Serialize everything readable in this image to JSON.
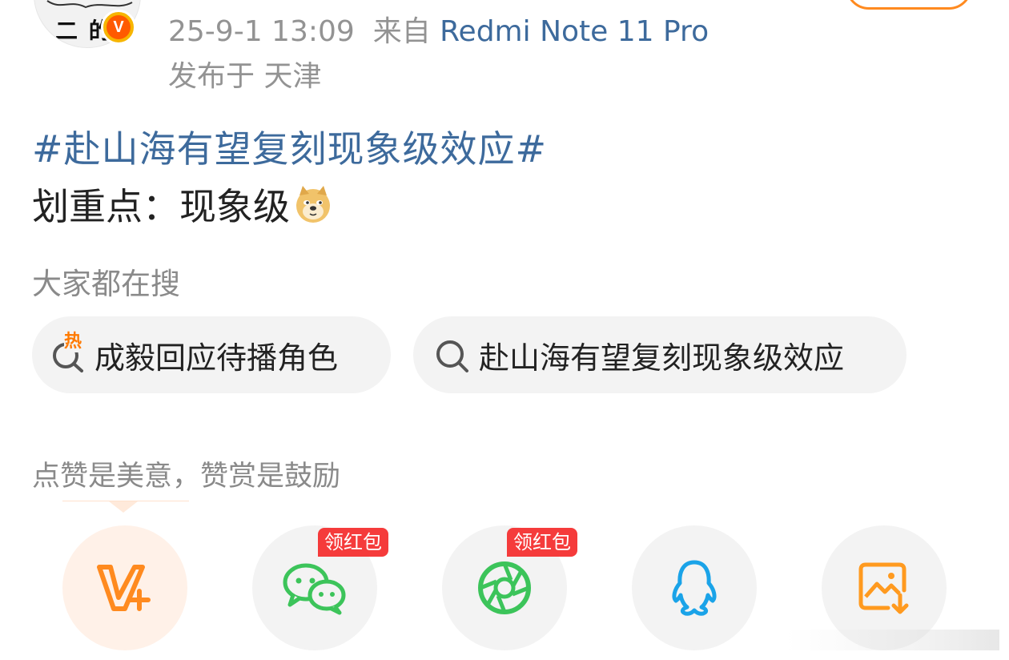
{
  "header": {
    "avatar_text": "二 的",
    "verified_badge": "V",
    "timestamp": "25-9-1 13:09",
    "from_label": "来自",
    "device": "Redmi Note 11 Pro",
    "location": "发布于 天津"
  },
  "post": {
    "topic": "#赴山海有望复刻现象级效应#",
    "text": "划重点：现象级",
    "emoji": "doge-emoji"
  },
  "search": {
    "title": "大家都在搜",
    "chips": [
      {
        "label": "成毅回应待播角色",
        "icon": "hot-search-icon",
        "hot_mark": "热"
      },
      {
        "label": "赴山海有望复刻现象级效应",
        "icon": "search-icon"
      }
    ]
  },
  "tip": {
    "text": "点赞是美意，赞赏是鼓励"
  },
  "share": {
    "buttons": [
      {
        "name": "vplus",
        "icon": "vplus-icon"
      },
      {
        "name": "wechat",
        "icon": "wechat-icon",
        "badge": "领红包"
      },
      {
        "name": "moments",
        "icon": "moments-icon",
        "badge": "领红包"
      },
      {
        "name": "qq",
        "icon": "qq-icon"
      },
      {
        "name": "save-image",
        "icon": "save-image-icon"
      }
    ]
  },
  "colors": {
    "link_blue": "#3d6a9c",
    "meta_gray": "#939393",
    "accent_orange": "#ff8a1f",
    "badge_red": "#f53b3b",
    "wechat_green": "#3cc45a",
    "qq_blue": "#1aa3e8"
  }
}
